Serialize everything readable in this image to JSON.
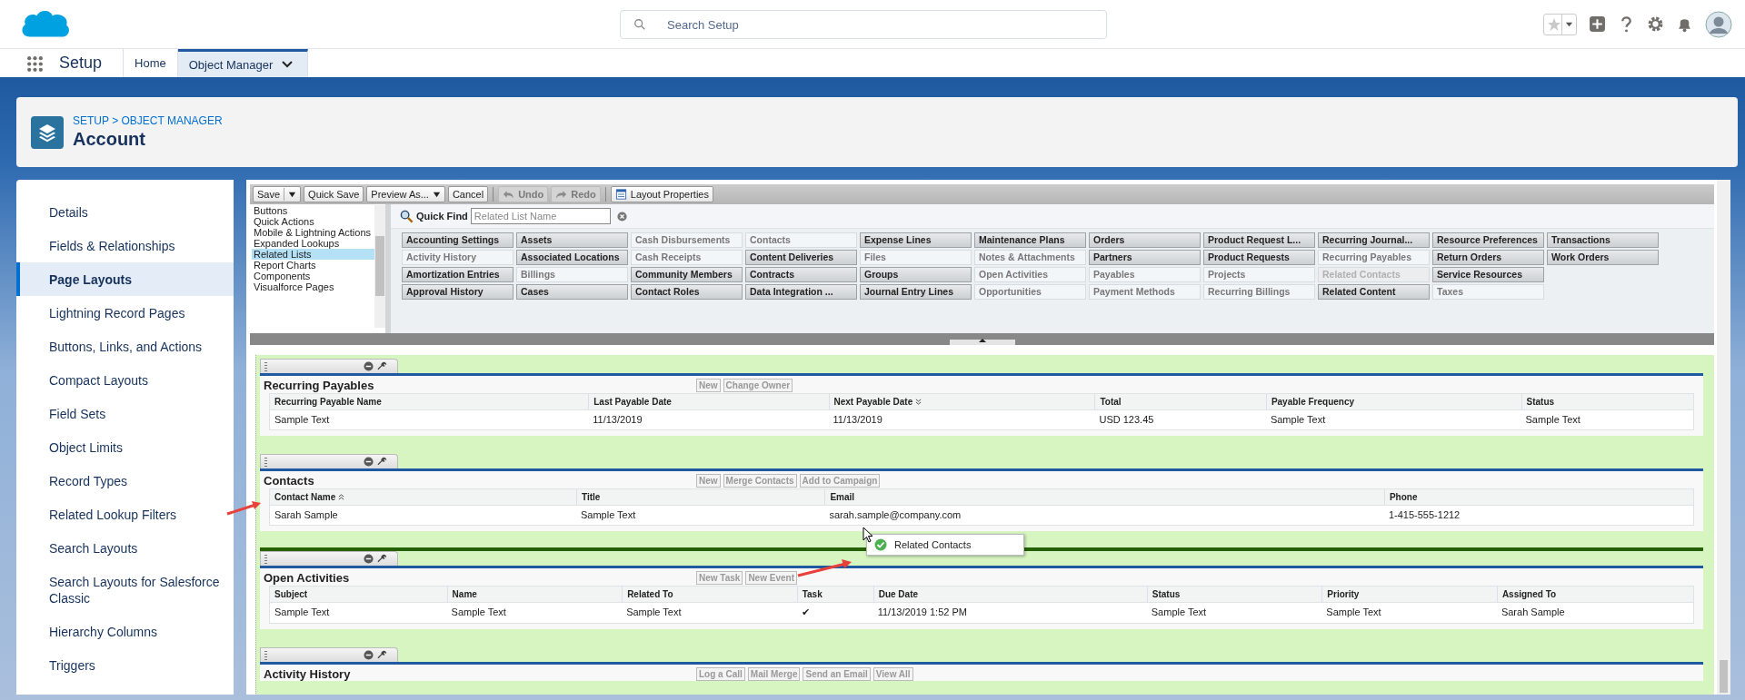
{
  "header": {
    "search_placeholder": "Search Setup"
  },
  "nav": {
    "app_name": "Setup",
    "tabs": [
      {
        "label": "Home",
        "selected": false
      },
      {
        "label": "Object Manager",
        "selected": true
      }
    ]
  },
  "page_header": {
    "breadcrumb": "SETUP > OBJECT MANAGER",
    "title": "Account"
  },
  "sidebar": {
    "items": [
      {
        "label": "Details",
        "selected": false
      },
      {
        "label": "Fields & Relationships",
        "selected": false
      },
      {
        "label": "Page Layouts",
        "selected": true
      },
      {
        "label": "Lightning Record Pages",
        "selected": false
      },
      {
        "label": "Buttons, Links, and Actions",
        "selected": false
      },
      {
        "label": "Compact Layouts",
        "selected": false
      },
      {
        "label": "Field Sets",
        "selected": false
      },
      {
        "label": "Object Limits",
        "selected": false
      },
      {
        "label": "Record Types",
        "selected": false
      },
      {
        "label": "Related Lookup Filters",
        "selected": false
      },
      {
        "label": "Search Layouts",
        "selected": false
      },
      {
        "label": "Search Layouts for Salesforce Classic",
        "selected": false
      },
      {
        "label": "Hierarchy Columns",
        "selected": false
      },
      {
        "label": "Triggers",
        "selected": false
      }
    ]
  },
  "toolbar": {
    "buttons": [
      {
        "label": "Save",
        "kind": "split",
        "disabled": false
      },
      {
        "label": "Quick Save",
        "kind": "plain",
        "disabled": false
      },
      {
        "label": "Preview As...",
        "kind": "dropdown",
        "disabled": false
      },
      {
        "label": "Cancel",
        "kind": "plain",
        "disabled": false
      },
      {
        "label": "Undo",
        "kind": "undo",
        "disabled": true
      },
      {
        "label": "Redo",
        "kind": "redo",
        "disabled": true
      },
      {
        "label": "Layout Properties",
        "kind": "properties",
        "disabled": false
      }
    ]
  },
  "palette": {
    "categories": [
      {
        "label": "Buttons",
        "selected": false
      },
      {
        "label": "Quick Actions",
        "selected": false
      },
      {
        "label": "Mobile & Lightning Actions",
        "selected": false
      },
      {
        "label": "Expanded Lookups",
        "selected": false
      },
      {
        "label": "Related Lists",
        "selected": true
      },
      {
        "label": "Report Charts",
        "selected": false
      },
      {
        "label": "Components",
        "selected": false
      },
      {
        "label": "Visualforce Pages",
        "selected": false
      }
    ],
    "quick_find": {
      "label": "Quick Find",
      "placeholder": "Related List Name"
    },
    "rows": [
      [
        {
          "label": "Accounting Settings",
          "kind": "available"
        },
        {
          "label": "Assets",
          "kind": "available"
        },
        {
          "label": "Cash Disbursements",
          "kind": "placed"
        },
        {
          "label": "Contacts",
          "kind": "placed"
        },
        {
          "label": "Expense Lines",
          "kind": "available"
        },
        {
          "label": "Maintenance Plans",
          "kind": "available"
        },
        {
          "label": "Orders",
          "kind": "available"
        },
        {
          "label": "Product Request L...",
          "kind": "available"
        },
        {
          "label": "Recurring Journal...",
          "kind": "available"
        },
        {
          "label": "Resource Preferences",
          "kind": "available"
        },
        {
          "label": "Transactions",
          "kind": "available"
        }
      ],
      [
        {
          "label": "Activity History",
          "kind": "placed"
        },
        {
          "label": "Associated Locations",
          "kind": "available"
        },
        {
          "label": "Cash Receipts",
          "kind": "placed"
        },
        {
          "label": "Content Deliveries",
          "kind": "available"
        },
        {
          "label": "Files",
          "kind": "placed"
        },
        {
          "label": "Notes & Attachments",
          "kind": "placed"
        },
        {
          "label": "Partners",
          "kind": "available"
        },
        {
          "label": "Product Requests",
          "kind": "available"
        },
        {
          "label": "Recurring Payables",
          "kind": "placed"
        },
        {
          "label": "Return Orders",
          "kind": "available"
        },
        {
          "label": "Work Orders",
          "kind": "available"
        }
      ],
      [
        {
          "label": "Amortization Entries",
          "kind": "available"
        },
        {
          "label": "Billings",
          "kind": "placed"
        },
        {
          "label": "Community Members",
          "kind": "available"
        },
        {
          "label": "Contracts",
          "kind": "available"
        },
        {
          "label": "Groups",
          "kind": "available"
        },
        {
          "label": "Open Activities",
          "kind": "placed"
        },
        {
          "label": "Payables",
          "kind": "placed"
        },
        {
          "label": "Projects",
          "kind": "placed"
        },
        {
          "label": "Related Contacts",
          "kind": "dragging"
        },
        {
          "label": "Service Resources",
          "kind": "available"
        }
      ],
      [
        {
          "label": "Approval History",
          "kind": "available"
        },
        {
          "label": "Cases",
          "kind": "available"
        },
        {
          "label": "Contact Roles",
          "kind": "available"
        },
        {
          "label": "Data Integration ...",
          "kind": "available"
        },
        {
          "label": "Journal Entry Lines",
          "kind": "available"
        },
        {
          "label": "Opportunities",
          "kind": "placed"
        },
        {
          "label": "Payment Methods",
          "kind": "placed"
        },
        {
          "label": "Recurring Billings",
          "kind": "placed"
        },
        {
          "label": "Related Content",
          "kind": "available"
        },
        {
          "label": "Taxes",
          "kind": "placed"
        }
      ]
    ]
  },
  "sections": [
    {
      "title": "Recurring Payables",
      "drop_below": false,
      "buttons": [
        "New",
        "Change Owner"
      ],
      "columns": [
        {
          "label": "Recurring Payable Name",
          "kind": "plain"
        },
        {
          "label": "Last Payable Date",
          "kind": "plain"
        },
        {
          "label": "Next Payable Date",
          "kind": "sort_desc"
        },
        {
          "label": "Total",
          "kind": "plain"
        },
        {
          "label": "Payable Frequency",
          "kind": "plain"
        },
        {
          "label": "Status",
          "kind": "plain"
        }
      ],
      "rows": [
        [
          "Sample Text",
          "11/13/2019",
          "11/13/2019",
          "USD 123.45",
          "Sample Text",
          "Sample Text"
        ]
      ]
    },
    {
      "title": "Contacts",
      "drop_below": true,
      "buttons": [
        "New",
        "Merge Contacts",
        "Add to Campaign"
      ],
      "columns": [
        {
          "label": "Contact Name",
          "kind": "sort_asc"
        },
        {
          "label": "Title",
          "kind": "plain"
        },
        {
          "label": "Email",
          "kind": "plain"
        },
        {
          "label": "Phone",
          "kind": "plain"
        }
      ],
      "rows": [
        [
          "Sarah Sample",
          "Sample Text",
          "sarah.sample@company.com",
          "1-415-555-1212"
        ]
      ]
    },
    {
      "title": "Open Activities",
      "drop_below": false,
      "buttons": [
        "New Task",
        "New Event"
      ],
      "columns": [
        {
          "label": "Subject",
          "kind": "plain"
        },
        {
          "label": "Name",
          "kind": "plain"
        },
        {
          "label": "Related To",
          "kind": "plain"
        },
        {
          "label": "Task",
          "kind": "plain"
        },
        {
          "label": "Due Date",
          "kind": "plain"
        },
        {
          "label": "Status",
          "kind": "plain"
        },
        {
          "label": "Priority",
          "kind": "plain"
        },
        {
          "label": "Assigned To",
          "kind": "plain"
        }
      ],
      "rows": [
        [
          "Sample Text",
          "Sample Text",
          "Sample Text",
          "✔",
          "11/13/2019 1:52 PM",
          "Sample Text",
          "Sample Text",
          "Sarah Sample"
        ]
      ]
    },
    {
      "title": "Activity History",
      "drop_below": false,
      "buttons": [
        "Log a Call",
        "Mail Merge",
        "Send an Email",
        "View All"
      ]
    }
  ],
  "drag_tooltip": {
    "label": "Related Contacts"
  }
}
